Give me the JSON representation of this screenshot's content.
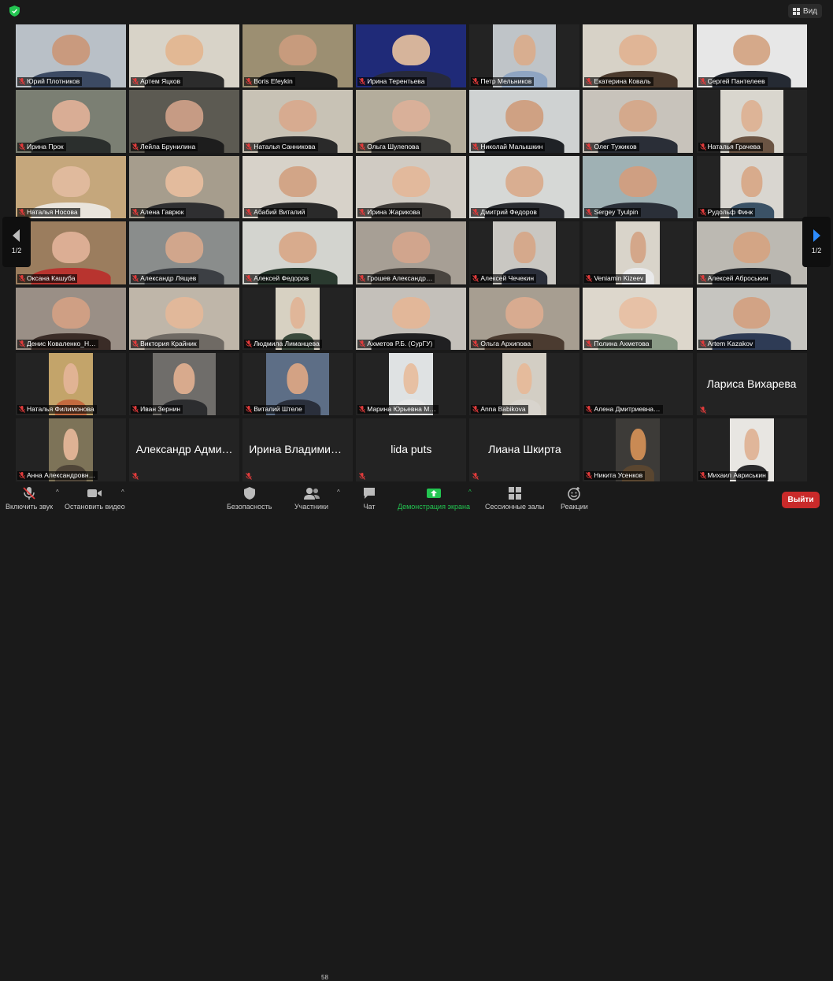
{
  "top": {
    "view_label": "Вид"
  },
  "pager": {
    "left_label": "1/2",
    "right_label": "1/2"
  },
  "participants": [
    {
      "name": "Юрий Плотников",
      "bg": "#b9c0c7",
      "skin": "#c99a7e",
      "cloth": "#3c4a63",
      "size": "full"
    },
    {
      "name": "Артем Яцков",
      "bg": "#d8d3c8",
      "skin": "#e2b894",
      "cloth": "#2c2c2c",
      "size": "full"
    },
    {
      "name": "Boris Efeykin",
      "bg": "#9c8f72",
      "skin": "#c79b7d",
      "cloth": "#1e1e1e",
      "size": "full"
    },
    {
      "name": "Ирина Терентьева",
      "bg": "#1f2a78",
      "skin": "#d6b49b",
      "cloth": "#272a3b",
      "size": "full"
    },
    {
      "name": "Петр Мельников",
      "bg": "#bfc4c8",
      "skin": "#d8ae90",
      "cloth": "#8fa5c2",
      "size": "mid"
    },
    {
      "name": "Екатерина Коваль",
      "bg": "#d7d2c7",
      "skin": "#e0b596",
      "cloth": "#4b3a2d",
      "size": "full"
    },
    {
      "name": "Сергей Пантелеев",
      "bg": "#e7e7e7",
      "skin": "#d5a98a",
      "cloth": "#252a33",
      "size": "full",
      "active": true
    },
    {
      "name": "Ирина Прок",
      "bg": "#7b7f73",
      "skin": "#d9ad95",
      "cloth": "#2b2f2d",
      "size": "full"
    },
    {
      "name": "Лейла Брунилина",
      "bg": "#5c5a52",
      "skin": "#c69b84",
      "cloth": "#1d1d1d",
      "size": "full"
    },
    {
      "name": "Наталья Санникова",
      "bg": "#c8c2b5",
      "skin": "#d7ab90",
      "cloth": "#2a2a2a",
      "size": "full"
    },
    {
      "name": "Ольга Шулепова",
      "bg": "#b4ad9c",
      "skin": "#d9b099",
      "cloth": "#3e3d3a",
      "size": "full"
    },
    {
      "name": "Николай Малышкин",
      "bg": "#cfd2d2",
      "skin": "#cfa183",
      "cloth": "#1f2226",
      "size": "full"
    },
    {
      "name": "Олег Тужиков",
      "bg": "#c8c3bb",
      "skin": "#d4a98c",
      "cloth": "#2a2e37",
      "size": "full"
    },
    {
      "name": "Наталья Грачева",
      "bg": "#d9d6ce",
      "skin": "#ddb497",
      "cloth": "#6b5443",
      "size": "mid"
    },
    {
      "name": "Наталья Носова",
      "bg": "#c5a77c",
      "skin": "#e0ba9d",
      "cloth": "#e9e4dc",
      "size": "full"
    },
    {
      "name": "Алена Гаврюк",
      "bg": "#a69d8d",
      "skin": "#e3bb9d",
      "cloth": "#2f2f31",
      "size": "full"
    },
    {
      "name": "Абабий Виталий",
      "bg": "#d7d2c9",
      "skin": "#d2a587",
      "cloth": "#2a2a2a",
      "size": "full"
    },
    {
      "name": "Ирина Жарикова",
      "bg": "#d0cbc3",
      "skin": "#e2b99c",
      "cloth": "#3d3a37",
      "size": "full"
    },
    {
      "name": "Дмитрий Федоров",
      "bg": "#d6d8d6",
      "skin": "#d9ae91",
      "cloth": "#2a2c31",
      "size": "full"
    },
    {
      "name": "Sergey Tyulpin",
      "bg": "#9fb1b4",
      "skin": "#cf9f82",
      "cloth": "#2a2f38",
      "size": "full"
    },
    {
      "name": "Рудольф Финк",
      "bg": "#d9d6d0",
      "skin": "#d8ab8c",
      "cloth": "#3b5266",
      "size": "mid"
    },
    {
      "name": "Оксана Кашуба",
      "bg": "#9b7d5e",
      "skin": "#dcae94",
      "cloth": "#b8342f",
      "size": "full"
    },
    {
      "name": "Александр Лящев",
      "bg": "#8a8d8c",
      "skin": "#d1a68c",
      "cloth": "#3c3f44",
      "size": "full"
    },
    {
      "name": "Алексей Федоров",
      "bg": "#d3d4cf",
      "skin": "#d8ab8d",
      "cloth": "#2a3a2f",
      "size": "full"
    },
    {
      "name": "Грошев Александр…",
      "bg": "#a79f95",
      "skin": "#d1a58d",
      "cloth": "#4a4540",
      "size": "full"
    },
    {
      "name": "Алексей Чечекин",
      "bg": "#c9c7c2",
      "skin": "#d5a98c",
      "cloth": "#2b2f3a",
      "size": "mid"
    },
    {
      "name": "Veniamin Kizeev",
      "bg": "#d9d4ca",
      "skin": "#d4a78a",
      "cloth": "#e9e9ea",
      "size": "narrow"
    },
    {
      "name": "Алексей Аброськин",
      "bg": "#bcb9b2",
      "skin": "#d3a585",
      "cloth": "#26292d",
      "size": "full"
    },
    {
      "name": "Денис Коваленко_Н…",
      "bg": "#9a8f86",
      "skin": "#cf9f84",
      "cloth": "#3a2c27",
      "size": "full"
    },
    {
      "name": "Виктория Крайник",
      "bg": "#bfb6a9",
      "skin": "#e1b89a",
      "cloth": "#6f6a64",
      "size": "full"
    },
    {
      "name": "Людмила Лиманцева",
      "bg": "#d7d1c2",
      "skin": "#e0b699",
      "cloth": "#3a4a3c",
      "size": "narrow"
    },
    {
      "name": "Ахметов Р.Б. (СурГУ)",
      "bg": "#c4c0ba",
      "skin": "#e2b799",
      "cloth": "#202022",
      "size": "full"
    },
    {
      "name": "Ольга Архипова",
      "bg": "#a79e91",
      "skin": "#d8ab90",
      "cloth": "#4b3b30",
      "size": "full"
    },
    {
      "name": "Полина Ахметова",
      "bg": "#ddd7cc",
      "skin": "#e7c1a6",
      "cloth": "#8a9a86",
      "size": "full"
    },
    {
      "name": "Artem Kazakov",
      "bg": "#c6c5c0",
      "skin": "#d2a385",
      "cloth": "#2e3b55",
      "size": "full"
    },
    {
      "name": "Наталья Филимонова",
      "bg": "#c3a46a",
      "skin": "#e1b394",
      "cloth": "#c46a3f",
      "size": "narrow"
    },
    {
      "name": "Иван Зернин",
      "bg": "#6f6d6a",
      "skin": "#d8aa8d",
      "cloth": "#2c2d2f",
      "size": "mid"
    },
    {
      "name": "Виталий Штеле",
      "bg": "#5d6e86",
      "skin": "#d3a284",
      "cloth": "#2a2f3b",
      "size": "mid"
    },
    {
      "name": "Марина Юрьевна М…",
      "bg": "#dfe2e3",
      "skin": "#e7c0a3",
      "cloth": "#e8e8e8",
      "size": "narrow"
    },
    {
      "name": "Anna Babikova",
      "bg": "#d3cec4",
      "skin": "#e5bb9c",
      "cloth": "#d8d4cd",
      "size": "narrow"
    },
    {
      "name": "Алена Дмитриевна…",
      "bg": "",
      "size": "none"
    },
    {
      "name": "",
      "big": "Лариса Вихарева",
      "size": "none"
    },
    {
      "name": "Анна Александровн…",
      "bg": "#7d7358",
      "skin": "#deb294",
      "cloth": "#4f4538",
      "size": "narrow"
    },
    {
      "name": "",
      "big": "Александр Адми…",
      "size": "none"
    },
    {
      "name": "",
      "big": "Ирина Владимир…",
      "size": "none"
    },
    {
      "name": "",
      "big": "lida puts",
      "size": "none"
    },
    {
      "name": "",
      "big": "Лиана Шкирта",
      "size": "none"
    },
    {
      "name": "Никита Усенков",
      "bg": "#3d3b38",
      "skin": "#c98a54",
      "cloth": "#5a4630",
      "size": "narrow"
    },
    {
      "name": "Михаил Авриськин",
      "bg": "#e8e6e2",
      "skin": "#e0b69a",
      "cloth": "#2a2a2c",
      "size": "narrow"
    }
  ],
  "toolbar": {
    "mute": "Включить звук",
    "video": "Остановить видео",
    "security": "Безопасность",
    "participants": "Участники",
    "participants_count": "58",
    "chat": "Чат",
    "share": "Демонстрация экрана",
    "breakout": "Сессионные залы",
    "reactions": "Реакции",
    "leave": "Выйти"
  },
  "colors": {
    "share_green": "#23c551",
    "leave_red": "#c92a2a",
    "muted_red": "#e23b3b",
    "active_border": "#c4d66a"
  }
}
